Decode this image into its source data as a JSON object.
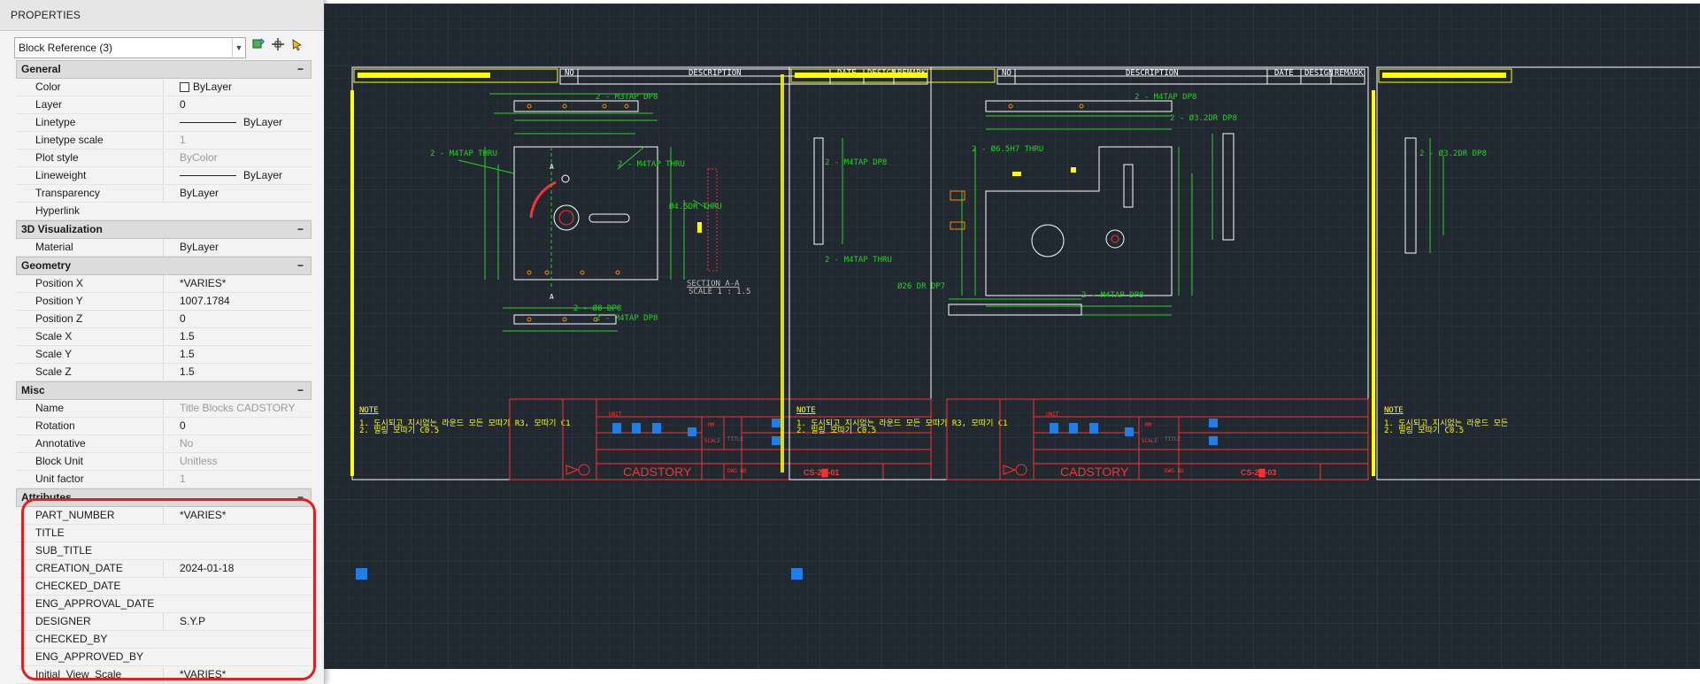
{
  "palette": {
    "title": "PROPERTIES",
    "selector_value": "Block Reference (3)",
    "tools": [
      {
        "icon": "quick-select-icon"
      },
      {
        "icon": "pickadd-icon"
      },
      {
        "icon": "select-objects-icon"
      }
    ],
    "sections": {
      "general": {
        "label": "General",
        "rows": [
          {
            "name": "Color",
            "value": "ByLayer"
          },
          {
            "name": "Layer",
            "value": "0"
          },
          {
            "name": "Linetype",
            "value": "ByLayer"
          },
          {
            "name": "Linetype scale",
            "value": "1"
          },
          {
            "name": "Plot style",
            "value": "ByColor"
          },
          {
            "name": "Lineweight",
            "value": "ByLayer"
          },
          {
            "name": "Transparency",
            "value": "ByLayer"
          },
          {
            "name": "Hyperlink",
            "value": ""
          }
        ]
      },
      "visualization": {
        "label": "3D Visualization",
        "rows": [
          {
            "name": "Material",
            "value": "ByLayer"
          }
        ]
      },
      "geometry": {
        "label": "Geometry",
        "rows": [
          {
            "name": "Position X",
            "value": "*VARIES*"
          },
          {
            "name": "Position Y",
            "value": "1007.1784"
          },
          {
            "name": "Position Z",
            "value": "0"
          },
          {
            "name": "Scale X",
            "value": "1.5"
          },
          {
            "name": "Scale Y",
            "value": "1.5"
          },
          {
            "name": "Scale Z",
            "value": "1.5"
          }
        ]
      },
      "misc": {
        "label": "Misc",
        "rows": [
          {
            "name": "Name",
            "value": "Title Blocks CADSTORY"
          },
          {
            "name": "Rotation",
            "value": "0"
          },
          {
            "name": "Annotative",
            "value": "No"
          },
          {
            "name": "Block Unit",
            "value": "Unitless"
          },
          {
            "name": "Unit factor",
            "value": "1"
          }
        ]
      },
      "attributes": {
        "label": "Attributes",
        "rows": [
          {
            "name": "PART_NUMBER",
            "value": "*VARIES*"
          },
          {
            "name": "TITLE",
            "value": ""
          },
          {
            "name": "SUB_TITLE",
            "value": ""
          },
          {
            "name": "CREATION_DATE",
            "value": "2024-01-18"
          },
          {
            "name": "CHECKED_DATE",
            "value": ""
          },
          {
            "name": "ENG_APPROVAL_DATE",
            "value": ""
          },
          {
            "name": "DESIGNER",
            "value": "S.Y.P"
          },
          {
            "name": "CHECKED_BY",
            "value": ""
          },
          {
            "name": "ENG_APPROVED_BY",
            "value": ""
          },
          {
            "name": "Initial_View_Scale",
            "value": "*VARIES*"
          }
        ]
      }
    },
    "collapse_glyph": "−"
  },
  "drawing": {
    "sheets": [
      {
        "company": "CADSTORY",
        "drawing_no": "CS-2▇-01",
        "note_label": "NOTE",
        "note_lines": [
          "1. 도시되고 지시없는 라운드 모든 모따기 R3, 모따기 C1",
          "2. 밀링 모따기 C0.5"
        ],
        "section_label": "SECTION A-A",
        "section_scale": "SCALE 1 : 1.5",
        "header_cells": [
          "NO",
          "DESCRIPTION",
          "DATE",
          "DESIGN",
          "REMARK"
        ],
        "title_cells": [
          "UNIT",
          "MM",
          "SCALE",
          "TITLE",
          "DWG NO"
        ]
      },
      {
        "company": "CADSTORY",
        "drawing_no": "CS-2▇-03",
        "note_label": "NOTE",
        "note_lines": [
          "1. 도시되고 지시없는 라운드 모든 모따기 R3, 모따기 C1",
          "2. 밀링 모따기 C0.5"
        ],
        "header_cells": [
          "NO",
          "DESCRIPTION",
          "DATE",
          "DESIGN",
          "REMARK"
        ],
        "title_cells": [
          "UNIT",
          "MM",
          "SCALE",
          "TITLE",
          "DWG NO"
        ]
      },
      {
        "note_label": "NOTE",
        "note_lines": [
          "1. 도시되고 지시없는 라운드 모든",
          "2. 밀링 모따기 C0.5"
        ]
      }
    ],
    "dim_labels": [
      "2 - M3TAP DP8",
      "2 - M4TAP THRU",
      "2 - Ø6.5H7 THRU",
      "2 - Ø8 DP8",
      "Ø4.5DR THRU",
      "2 - M4TAP DP8",
      "Ø26 DR DP7",
      "2 - Ø3.2DR DP8"
    ],
    "grip_color": "#1f7fe6",
    "line_colors": {
      "frame": "#ffffff",
      "part": "#ffffff",
      "dimension": "#22d422",
      "leader": "#22d422",
      "title_block": "#ff3030",
      "yellow": "#ffff00",
      "hidden": "#ff8a00"
    }
  }
}
